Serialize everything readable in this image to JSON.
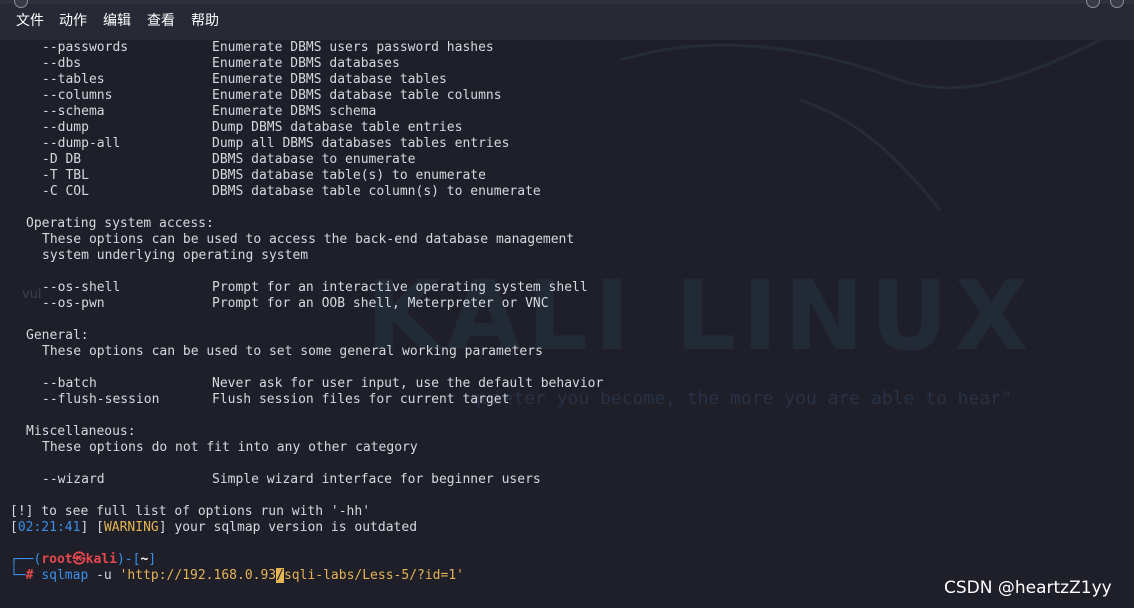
{
  "menubar": {
    "items": [
      "文件",
      "动作",
      "编辑",
      "查看",
      "帮助"
    ]
  },
  "background": {
    "logo_text": "KALI LINUX",
    "quote_text": "quieter you become, the more you are able to hear\"",
    "left_fragment": "vul"
  },
  "help": {
    "enum_options": [
      {
        "opt": "--passwords",
        "desc": "Enumerate DBMS users password hashes"
      },
      {
        "opt": "--dbs",
        "desc": "Enumerate DBMS databases"
      },
      {
        "opt": "--tables",
        "desc": "Enumerate DBMS database tables"
      },
      {
        "opt": "--columns",
        "desc": "Enumerate DBMS database table columns"
      },
      {
        "opt": "--schema",
        "desc": "Enumerate DBMS schema"
      },
      {
        "opt": "--dump",
        "desc": "Dump DBMS database table entries"
      },
      {
        "opt": "--dump-all",
        "desc": "Dump all DBMS databases tables entries"
      },
      {
        "opt": "-D DB",
        "desc": "DBMS database to enumerate"
      },
      {
        "opt": "-T TBL",
        "desc": "DBMS database table(s) to enumerate"
      },
      {
        "opt": "-C COL",
        "desc": "DBMS database table column(s) to enumerate"
      }
    ],
    "os_access": {
      "heading": "Operating system access:",
      "desc1": "These options can be used to access the back-end database management",
      "desc2": "system underlying operating system",
      "options": [
        {
          "opt": "--os-shell",
          "desc": "Prompt for an interactive operating system shell"
        },
        {
          "opt": "--os-pwn",
          "desc": "Prompt for an OOB shell, Meterpreter or VNC"
        }
      ]
    },
    "general": {
      "heading": "General:",
      "desc1": "These options can be used to set some general working parameters",
      "options": [
        {
          "opt": "--batch",
          "desc": "Never ask for user input, use the default behavior"
        },
        {
          "opt": "--flush-session",
          "desc": "Flush session files for current target"
        }
      ]
    },
    "misc": {
      "heading": "Miscellaneous:",
      "desc1": "These options do not fit into any other category",
      "options": [
        {
          "opt": "--wizard",
          "desc": "Simple wizard interface for beginner users"
        }
      ]
    }
  },
  "messages": {
    "hint": "[!] to see full list of options run with '-hh'",
    "time": "02:21:41",
    "warning_tag": "WARNING",
    "warning_text": " your sqlmap version is outdated"
  },
  "prompt": {
    "line1_prefix": "┌──(",
    "user": "root",
    "at": "㉿",
    "host": "kali",
    "line1_mid": ")-[",
    "dir": "~",
    "line1_end": "]",
    "line2_prefix": "└─",
    "hash": "#",
    "cmd": "sqlmap",
    "flag": "-u",
    "url_before": "'http://192.168.0.93",
    "url_cursor": "/",
    "url_after": "sqli-labs/Less-5/?id=1'"
  },
  "watermark": "CSDN @heartzZ1yy",
  "colors": {
    "background": "#1e1f29",
    "menubar": "#272a34",
    "prompt_blue": "#3a8fe8",
    "prompt_red": "#e5484d",
    "url_yellow": "#e5b454"
  }
}
